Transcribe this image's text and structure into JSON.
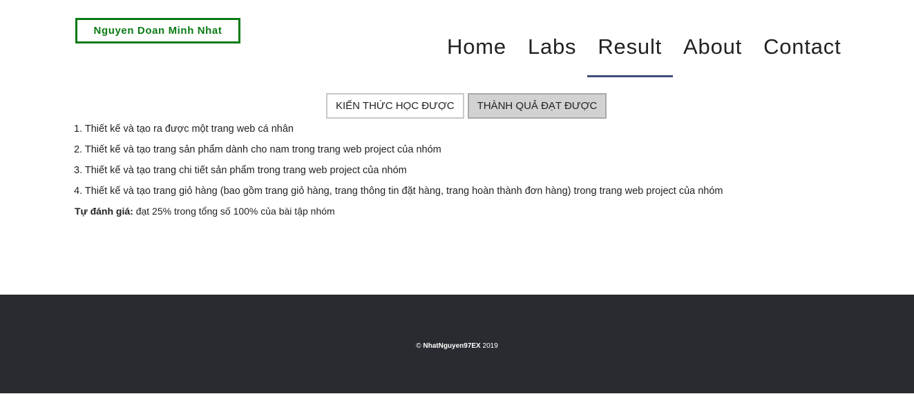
{
  "header": {
    "logo_text": "Nguyen Doan Minh Nhat",
    "nav": [
      {
        "label": "Home"
      },
      {
        "label": "Labs"
      },
      {
        "label": "Result"
      },
      {
        "label": "About"
      },
      {
        "label": "Contact"
      }
    ],
    "active_nav": "Result"
  },
  "tabs": [
    {
      "label": "KIẾN THỨC HỌC ĐƯỢC"
    },
    {
      "label": "THÀNH QUẢ ĐẠT ĐƯỢC"
    }
  ],
  "active_tab": "THÀNH QUẢ ĐẠT ĐƯỢC",
  "results": [
    "1. Thiết kế và tạo ra được một trang web cá nhân",
    "2. Thiết kế và tạo trang sản phẩm dành cho nam trong trang web project của nhóm",
    "3. Thiết kế và tạo trang chi tiết sản phẩm trong trang web project của nhóm",
    "4. Thiết kế và tạo trang giỏ hàng (bao gồm trang giỏ hàng, trang thông tin đặt hàng, trang hoàn thành đơn hàng) trong trang web project của nhóm"
  ],
  "assessment": {
    "label": "Tự đánh giá:",
    "text": " đạt 25% trong tổng số 100% của bài tập nhóm"
  },
  "footer": {
    "symbol": "©",
    "author": "NhatNguyen97EX",
    "year": " 2019"
  },
  "colors": {
    "logo_green": "#0a7a14",
    "nav_underline": "#3d4f78",
    "footer_bg": "#2a2b30"
  }
}
